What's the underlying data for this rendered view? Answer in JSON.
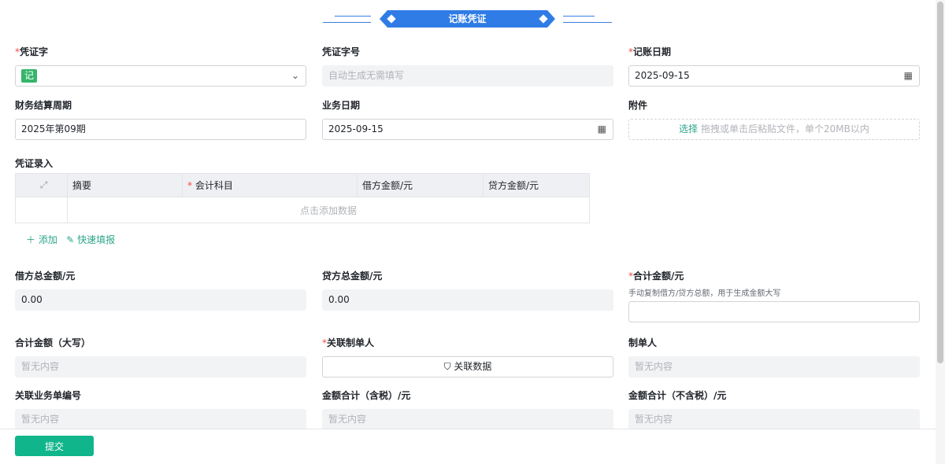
{
  "title": "记账凭证",
  "fields": {
    "voucher_word": {
      "label": "凭证字",
      "value": "记"
    },
    "voucher_no": {
      "label": "凭证字号",
      "placeholder": "自动生成无需填写"
    },
    "post_date": {
      "label": "记账日期",
      "value": "2025-09-15"
    },
    "period": {
      "label": "财务结算周期",
      "value": "2025年第09期"
    },
    "biz_date": {
      "label": "业务日期",
      "value": "2025-09-15"
    },
    "attachment": {
      "label": "附件",
      "select": "选择",
      "hint": "拖拽或单击后粘贴文件，单个20MB以内"
    },
    "debit_total": {
      "label": "借方总金额/元",
      "value": "0.00"
    },
    "credit_total": {
      "label": "贷方总金额/元",
      "value": "0.00"
    },
    "sum_amount": {
      "label": "合计金额/元",
      "hint": "手动复制借方/贷方总额，用于生成金额大写",
      "value": ""
    },
    "sum_upper": {
      "label": "合计金额（大写）",
      "placeholder": "暂无内容"
    },
    "related_maker": {
      "label": "关联制单人",
      "button": "关联数据"
    },
    "maker": {
      "label": "制单人",
      "placeholder": "暂无内容"
    },
    "related_no": {
      "label": "关联业务单编号",
      "placeholder": "暂无内容"
    },
    "amount_tax": {
      "label": "金额合计（含税）/元",
      "placeholder": "暂无内容"
    },
    "amount_notax": {
      "label": "金额合计（不含税）/元",
      "placeholder": "暂无内容"
    }
  },
  "entries": {
    "label": "凭证录入",
    "columns": [
      "摘要",
      "会计科目",
      "借方金额/元",
      "贷方金额/元"
    ],
    "empty": "点击添加数据",
    "add": "添加",
    "quick": "快速填报"
  },
  "submit": "提交"
}
